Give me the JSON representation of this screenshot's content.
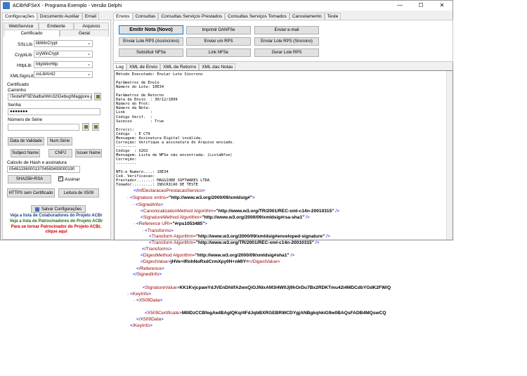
{
  "window": {
    "title": "ACBrNFSeX - Programa Exemplo - Versão Delphi",
    "controls": [
      "—",
      "☐",
      "✕"
    ]
  },
  "left_tabs": [
    "Configurações",
    "Documento Auxiliar",
    "Email"
  ],
  "left_subtabs_row1": [
    "WebService",
    "Emitente",
    "Arquivos"
  ],
  "left_subtabs_row2": [
    "Certificado",
    "Geral"
  ],
  "lib_settings": [
    {
      "label": "SSLLib",
      "value": "libWinCrypt"
    },
    {
      "label": "CryptLib",
      "value": "cryWinCrypt"
    },
    {
      "label": "HttpLib",
      "value": "httpWinHttp"
    },
    {
      "label": "XMLSignLib",
      "value": "xsLibXml2"
    }
  ],
  "certificado": {
    "group_label": "Certificado",
    "caminho_label": "Caminho",
    "caminho_value": "\\TesteNFSE\\batba\\Win32\\Debug\\Maggiore.pfx",
    "senha_label": "Senha",
    "senha_value": "●●●●●●●",
    "numserie_label": "Número de Série",
    "numserie_value": ""
  },
  "cert_buttons": {
    "data_validade": "Data de Validade",
    "num_serie": "Num.Série",
    "subject_name": "Subject Name",
    "cnpj": "CNPJ",
    "issuer_name": "Issuer Name"
  },
  "hash": {
    "label": "Calculo de Hash e assinatura",
    "value": "0548133600013704583493000190",
    "sha_button": "SHA256+RSA",
    "assinar_label": "Assinar"
  },
  "bottom_buttons": {
    "https": "HTTPS sem Certificado",
    "x509": "Leitura de X509",
    "salvar": "Salvar Configurações"
  },
  "notes": [
    {
      "text": "Veja a lista de Colaboradores do Projeto ACBr",
      "color": "#1f3f8f"
    },
    {
      "text": "Veja a lista de Patrocinadores do Projeto ACBr",
      "color": "#1f6f1f"
    },
    {
      "text": "Para se tornar Patrocinador do Projeto ACBr,",
      "color": "#cc0000"
    },
    {
      "text": "clique aqui",
      "color": "#cc0000"
    }
  ],
  "right_tabs": [
    "Envios",
    "Consultas",
    "Consultas Serviços Prestados",
    "Consultas Serviços Tomados",
    "Cancelamento",
    "Teste"
  ],
  "action_buttons": {
    "emitir": "Emitir Nota (Novo)",
    "imprimir": "Imprimir DANFSe",
    "email": "Enviar e-mail",
    "lote_assinc": "Enviar Lote RPS (Assincrono)",
    "um_rps": "Enviar um RPS",
    "lote_sinc": "Enviar Lote RPS (Sincrono)",
    "substituir": "Substituir NFSe",
    "link": "Link NFSe",
    "gerar": "Gerar Lote RPS"
  },
  "log_tabs": [
    "Log",
    "XML de Envio",
    "XML de Retorno",
    "XML das Notas"
  ],
  "log_lines": [
    "Método Executado: Enviar Lote Síncrono",
    "",
    "Parâmetros de Envio",
    "Número do Lote: 10E34",
    "",
    "Parâmetros de Retorno",
    "Data de Envio  : 30/12/1899",
    "Número do Prot:",
    "Número da Nota:",
    "Link           :",
    "Código Verif.  :",
    "Sucesso        : True",
    "",
    "Erro(s):",
    "Código  : E C79",
    "Mensagem: Assinatura Digital inválida.",
    "Correção: Verifique a assinatura do Arquivo enviado.",
    "---------",
    "Código  : X2O2",
    "Mensagem: Lista de NFSe não encontrada: (ListaNfse)",
    "Correção:",
    "---------",
    "",
    "NFS-e Numero....: 10E34",
    "Cod. Verificacao:",
    "Prestador.......: MAGGIORE SOFTWARES LTDA",
    "Tomador.........: INSCRICAO DE TESTE"
  ],
  "xml_lines": [
    {
      "marker": "",
      "pre": "</",
      "tag": "InfDeclaracaoPrestacaoServico",
      "post": ">",
      "attr": "",
      "val": "",
      "text": "",
      "close": ""
    },
    {
      "marker": "- ",
      "pre": "<",
      "tag": "Signature",
      "post": ">",
      "attr": " xmlns=",
      "val": "\"http://www.w3.org/2000/09/xmldsig#\"",
      "text": "",
      "close": ""
    },
    {
      "marker": "- ",
      "pre": "<",
      "tag": "SignedInfo",
      "post": ">",
      "attr": "",
      "val": "",
      "text": "",
      "close": ""
    },
    {
      "marker": "",
      "pre": "<",
      "tag": "CanonicalizationMethod",
      "post": " />",
      "attr": " Algorithm=",
      "val": "\"http://www.w3.org/TR/2001/REC-xml-c14n-20010315\"",
      "text": "",
      "close": ""
    },
    {
      "marker": "",
      "pre": "<",
      "tag": "SignatureMethod",
      "post": " />",
      "attr": " Algorithm=",
      "val": "\"http://www.w3.org/2000/09/xmldsig#rsa-sha1\"",
      "text": "",
      "close": ""
    },
    {
      "marker": "- ",
      "pre": "<",
      "tag": "Reference",
      "post": ">",
      "attr": " URI=",
      "val": "\"#rps1053485\"",
      "text": "",
      "close": ""
    },
    {
      "marker": "- ",
      "pre": "<",
      "tag": "Transforms",
      "post": ">",
      "attr": "",
      "val": "",
      "text": "",
      "close": ""
    },
    {
      "marker": "",
      "pre": "<",
      "tag": "Transform",
      "post": " />",
      "attr": " Algorithm=",
      "val": "\"http://www.w3.org/2000/09/xmldsig#enveloped-signature\"",
      "text": "",
      "close": ""
    },
    {
      "marker": "",
      "pre": "<",
      "tag": "Transform",
      "post": " />",
      "attr": " Algorithm=",
      "val": "\"http://www.w3.org/TR/2001/REC-xml-c14n-20010315\"",
      "text": "",
      "close": ""
    },
    {
      "marker": "",
      "pre": "</",
      "tag": "Transforms",
      "post": ">",
      "attr": "",
      "val": "",
      "text": "",
      "close": ""
    },
    {
      "marker": "",
      "pre": "<",
      "tag": "DigestMethod",
      "post": " />",
      "attr": " Algorithm=",
      "val": "\"http://www.w3.org/2000/09/xmldsig#sha1\"",
      "text": "",
      "close": ""
    },
    {
      "marker": "",
      "pre": "<",
      "tag": "DigestValue",
      "post": ">",
      "attr": "",
      "val": "",
      "text": "jHVe+lRnhNoRxdCrmXpy0H+nMIY=",
      "close": "</DigestValue>"
    },
    {
      "marker": "",
      "pre": "</",
      "tag": "Reference",
      "post": ">",
      "attr": "",
      "val": "",
      "text": "",
      "close": ""
    },
    {
      "marker": "",
      "pre": "</",
      "tag": "SignedInfo",
      "post": ">",
      "attr": "",
      "val": "",
      "text": "",
      "close": ""
    },
    {
      "marker": "",
      "pre": "<",
      "tag": "SignatureValue",
      "post": ">",
      "attr": "",
      "val": "",
      "text": "KK1KvjcpawYdJVEnDhI/fA2wxQiOJNlxAM3l4W0Jj9hOrDu7Bx2RDKTmu42i4MDCdbYGdK2FW/Q",
      "close": ""
    },
    {
      "marker": "- ",
      "pre": "<",
      "tag": "KeyInfo",
      "post": ">",
      "attr": "",
      "val": "",
      "text": "",
      "close": ""
    },
    {
      "marker": "- ",
      "pre": "<",
      "tag": "X509Data",
      "post": ">",
      "attr": "",
      "val": "",
      "text": "",
      "close": ""
    },
    {
      "marker": "",
      "pre": "<",
      "tag": "X509Certificate",
      "post": ">",
      "attr": "",
      "val": "",
      "text": "MIIIDzCCBfegAwIBAgIQKq/4FdJqbBXRGEBRWCDYgjANBgkqhkiG9w0BAQsFADB4MQswCQ",
      "close": ""
    },
    {
      "marker": "",
      "pre": "</",
      "tag": "X509Data",
      "post": ">",
      "attr": "",
      "val": "",
      "text": "",
      "close": ""
    },
    {
      "marker": "",
      "pre": "</",
      "tag": "KeyInfo",
      "post": ">",
      "attr": "",
      "val": "",
      "text": "",
      "close": ""
    }
  ]
}
